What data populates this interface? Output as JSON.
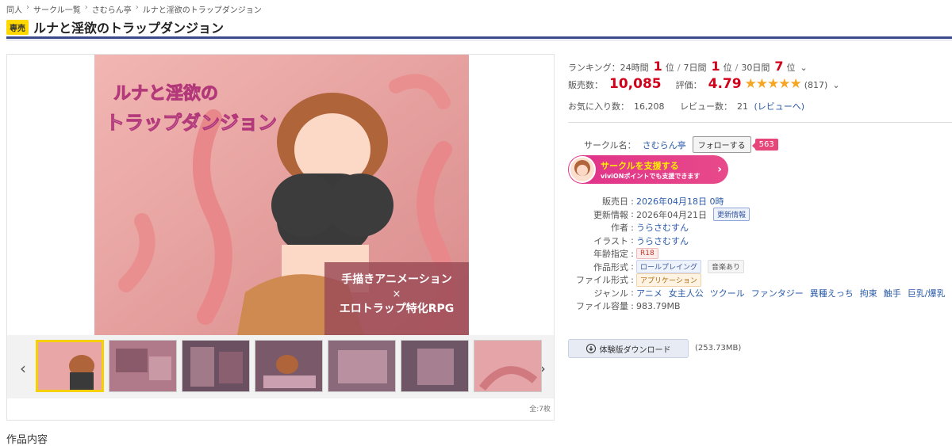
{
  "breadcrumb": [
    "同人",
    "サークル一覧",
    "さむらん亭",
    "ルナと淫欲のトラップダンジョン"
  ],
  "title": {
    "badge": "専売",
    "text": "ルナと淫欲のトラップダンジョン"
  },
  "cover": {
    "logo_line1": "ルナと淫欲の",
    "logo_line2": "トラップダンジョン",
    "caption_line1": "手描きアニメーション",
    "caption_x": "×",
    "caption_line2": "エロトラップ特化RPG"
  },
  "gallery": {
    "count_label": "全:7枚",
    "thumbnail_count": 7,
    "active_index": 0
  },
  "ranking": {
    "label": "ランキング：",
    "items": [
      {
        "period": "24時間",
        "rank": "1",
        "unit": "位"
      },
      {
        "period": "7日間",
        "rank": "1",
        "unit": "位"
      },
      {
        "period": "30日間",
        "rank": "7",
        "unit": "位"
      }
    ]
  },
  "sales": {
    "label": "販売数：",
    "value": "10,085"
  },
  "rating": {
    "label": "評価：",
    "value": "4.79",
    "stars": "★★★★★",
    "count": "(817)"
  },
  "favorites": {
    "label": "お気に入り数：",
    "value": "16,208"
  },
  "reviews": {
    "label": "レビュー数：",
    "value": "21",
    "link": "(レビューへ)"
  },
  "circle": {
    "label": "サークル名：",
    "name": "さむらん亭",
    "follow_label": "フォローする",
    "follow_count": "563"
  },
  "support": {
    "title": "サークルを支援する",
    "subtitle": "viviONポイントでも支援できます"
  },
  "spec": {
    "release_label": "販売日",
    "release_value": "2026年04月18日 0時",
    "update_label": "更新情報",
    "update_value": "2026年04月21日",
    "update_tag": "更新情報",
    "author_label": "作者",
    "author_value": "うらさむすん",
    "illust_label": "イラスト",
    "illust_value": "うらさむすん",
    "age_label": "年齢指定",
    "age_value": "R18",
    "format_label": "作品形式",
    "format_tag1": "ロールプレイング",
    "format_tag2": "音楽あり",
    "filetype_label": "ファイル形式",
    "filetype_value": "アプリケーション",
    "genre_label": "ジャンル",
    "genres": [
      "アニメ",
      "女主人公",
      "ツクール",
      "ファンタジー",
      "異種えっち",
      "拘束",
      "触手",
      "巨乳/爆乳"
    ],
    "size_label": "ファイル容量",
    "size_value": "983.79MB"
  },
  "download": {
    "label": "体験版ダウンロード",
    "size": "(253.73MB)"
  },
  "section": {
    "heading": "作品内容"
  }
}
